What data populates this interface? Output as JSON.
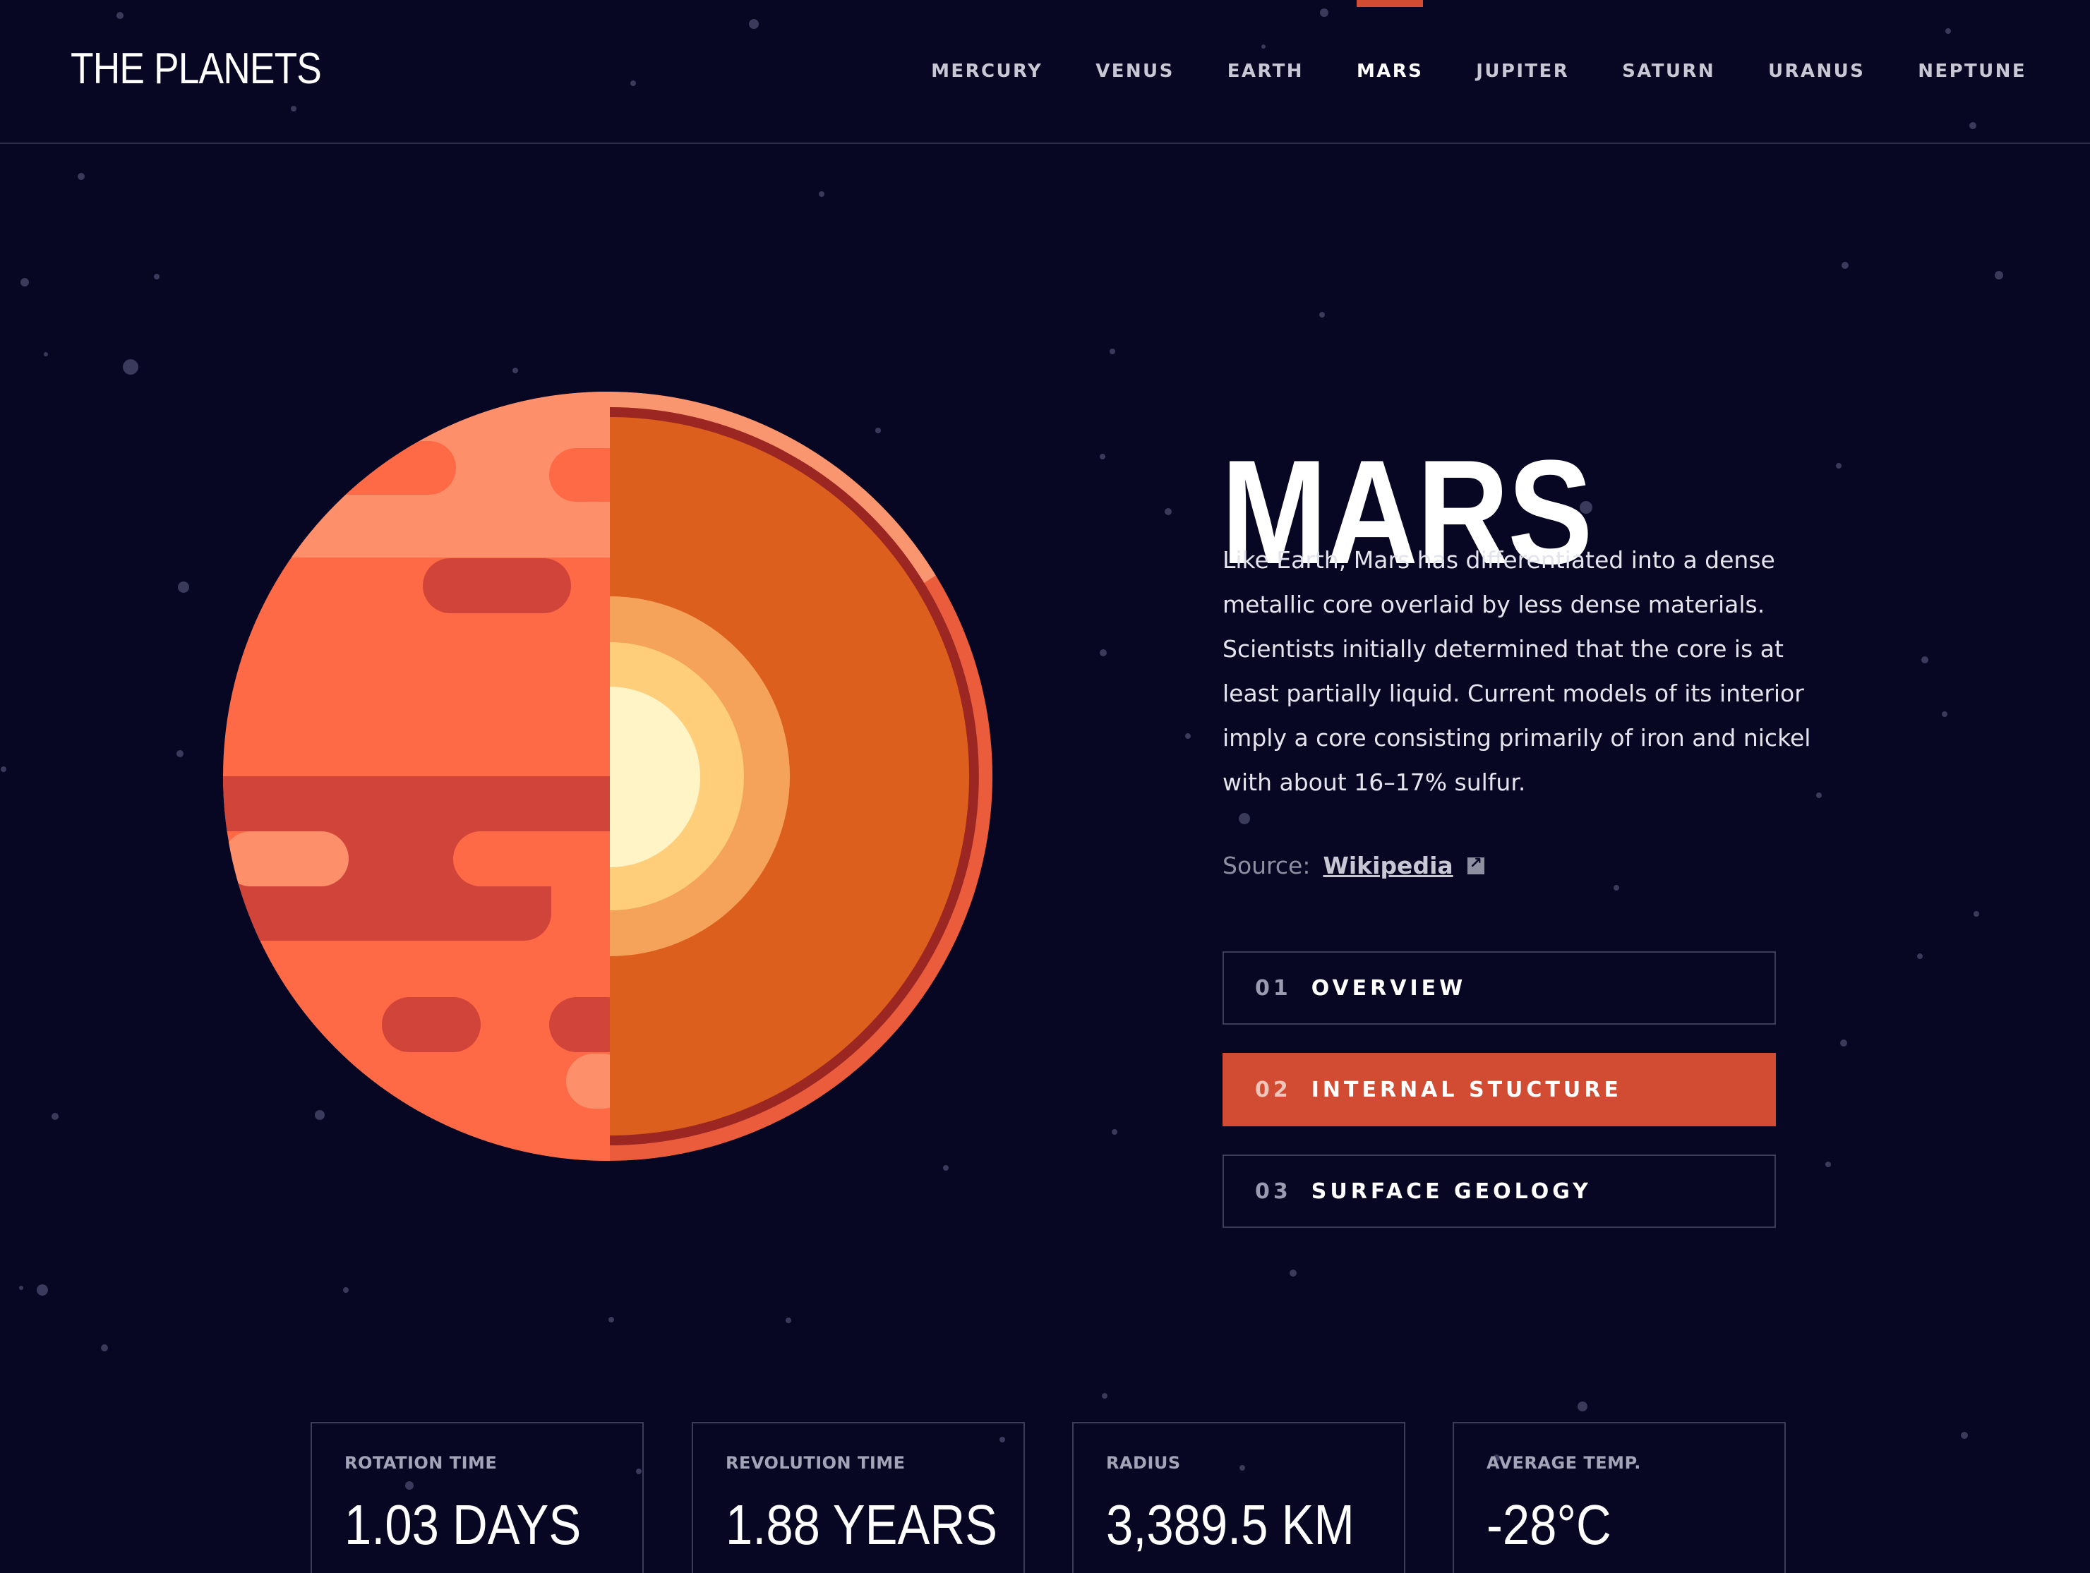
{
  "logo": "THE PLANETS",
  "nav": [
    {
      "label": "MERCURY"
    },
    {
      "label": "VENUS"
    },
    {
      "label": "EARTH"
    },
    {
      "label": "MARS",
      "active": true
    },
    {
      "label": "JUPITER"
    },
    {
      "label": "SATURN"
    },
    {
      "label": "URANUS"
    },
    {
      "label": "NEPTUNE"
    }
  ],
  "planet": {
    "name": "MARS",
    "description": "Like Earth, Mars has differentiated into a dense metallic core overlaid by less dense materials. Scientists initially determined that the core is at least partially liquid. Current models of its interior imply a core consisting primarily of iron and nickel with about 16–17% sulfur.",
    "source_label": "Source:",
    "source_link": "Wikipedia",
    "image": "mars-internal-structure-illustration"
  },
  "tabs": [
    {
      "num": "01",
      "label": "OVERVIEW"
    },
    {
      "num": "02",
      "label": "INTERNAL STUCTURE",
      "active": true
    },
    {
      "num": "03",
      "label": "SURFACE GEOLOGY"
    }
  ],
  "stats": [
    {
      "label": "ROTATION TIME",
      "value": "1.03 DAYS"
    },
    {
      "label": "REVOLUTION TIME",
      "value": "1.88 YEARS"
    },
    {
      "label": "RADIUS",
      "value": "3,389.5 KM"
    },
    {
      "label": "AVERAGE TEMP.",
      "value": "-28°C"
    }
  ],
  "colors": {
    "background": "#070724",
    "accent": "#d14c32",
    "border": "#3c3c58"
  }
}
